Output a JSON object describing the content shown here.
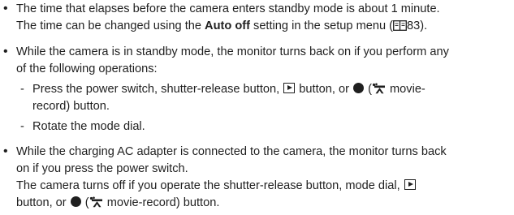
{
  "bullets": {
    "b1": {
      "line1": "The time that elapses before the camera enters standby mode is about 1 minute.",
      "line2_pre": "The time can be changed using the ",
      "line2_bold": "Auto off",
      "line2_post": " setting in the setup menu (",
      "line2_page": "83).",
      "book_icon": "book-ref-icon"
    },
    "b2": {
      "line1": "While the camera is in standby mode, the monitor turns back on if you perform any",
      "line2": "of the following operations:",
      "sub1_dash": "-",
      "sub1_pre": "Press the power switch, shutter-release button, ",
      "sub1_mid": " button, or ",
      "sub1_paren_open": " (",
      "sub1_movie": " movie-",
      "sub1_line2": "record) button.",
      "sub2_dash": "-",
      "sub2": "Rotate the mode dial."
    },
    "b3": {
      "line1": "While the charging AC adapter is connected to the camera, the monitor turns back",
      "line2": "on if you press the power switch.",
      "line3_pre": "The camera turns off if you operate the shutter-release button, mode dial, ",
      "line4_pre": "button, or ",
      "line4_paren_open": " (",
      "line4_post": " movie-record) button."
    }
  },
  "icons": {
    "bullet": "•",
    "playback": "playback-icon",
    "movie_record": "movie-record-icon",
    "record_dot": "record-dot-icon"
  }
}
